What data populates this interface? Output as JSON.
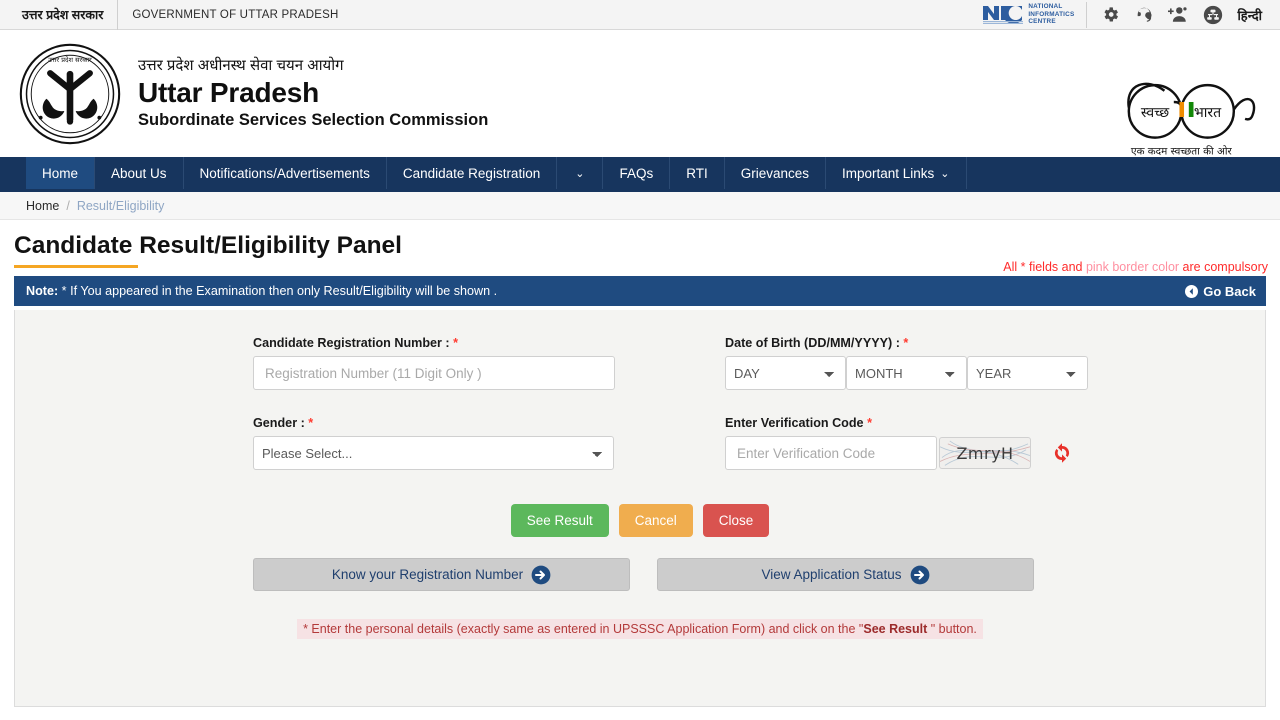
{
  "gov_bar": {
    "hindi_label": "उत्तर प्रदेश सरकार",
    "english_label": "GOVERNMENT OF UTTAR PRADESH",
    "nic_line1": "NATIONAL",
    "nic_line2": "INFORMATICS",
    "nic_line3": "CENTRE",
    "nic_mark": "NIC",
    "icons": [
      {
        "name": "gear-icon",
        "label": "Settings"
      },
      {
        "name": "headset-icon",
        "label": "Support"
      },
      {
        "name": "add-user-icon",
        "label": "Add User"
      },
      {
        "name": "accessibility-icon",
        "label": "Accessibility"
      }
    ],
    "language_label": "हिन्दी"
  },
  "masthead": {
    "hindi_title": "उत्तर प्रदेश अधीनस्थ सेवा चयन आयोग",
    "main_title": "Uttar Pradesh",
    "sub_title": "Subordinate Services Selection Commission",
    "emblem_name": "uttar-pradesh-emblem",
    "swachh_word1": "स्वच्छ",
    "swachh_word2": "भारत",
    "swachh_tagline": "एक कदम स्वच्छता की ओर"
  },
  "nav": {
    "items": [
      {
        "label": "Home",
        "active": true,
        "caret": false
      },
      {
        "label": "About Us",
        "active": false,
        "caret": false
      },
      {
        "label": "Notifications/Advertisements",
        "active": false,
        "caret": false
      },
      {
        "label": "Candidate Registration",
        "active": false,
        "caret": false
      },
      {
        "label": "",
        "active": false,
        "caret": true
      },
      {
        "label": "FAQs",
        "active": false,
        "caret": false
      },
      {
        "label": "RTI",
        "active": false,
        "caret": false
      },
      {
        "label": "Grievances",
        "active": false,
        "caret": false
      },
      {
        "label": "Important Links",
        "active": false,
        "caret": true
      }
    ]
  },
  "breadcrumb": {
    "home": "Home",
    "separator": "/",
    "current": "Result/Eligibility"
  },
  "page": {
    "title": "Candidate Result/Eligibility Panel",
    "compulsory_pre": "All * fields and ",
    "compulsory_pink": "pink border color",
    "compulsory_post": " are compulsory"
  },
  "note": {
    "bold": "Note:",
    "text": " * If You appeared in the Examination then only Result/Eligibility will be shown .",
    "go_back": "Go Back"
  },
  "form": {
    "reg_label": "Candidate Registration Number :",
    "reg_placeholder": "Registration Number (11 Digit Only )",
    "reg_value": "",
    "dob_label": "Date of Birth (DD/MM/YYYY) :",
    "dob_day": "DAY",
    "dob_month": "MONTH",
    "dob_year": "YEAR",
    "gender_label": "Gender :",
    "gender_value": "Please Select...",
    "captcha_label": "Enter Verification Code",
    "captcha_placeholder": "Enter Verification Code",
    "captcha_value": "",
    "captcha_text": "ZmryH",
    "refresh_name": "refresh-captcha-icon"
  },
  "buttons": {
    "see_result": "See Result",
    "cancel": "Cancel",
    "close": "Close",
    "know_reg": "Know your Registration Number",
    "view_status": "View Application Status"
  },
  "footer_note": {
    "pre": "* Enter the personal details (exactly same as entered in UPSSSC Application Form) and click on the ",
    "quote_open": "\"",
    "bold": "See Result",
    "quote_close": " \"",
    "post": " button."
  },
  "colors": {
    "nav_blue": "#17355e",
    "nav_active": "#1f4b80",
    "note_blue": "#1f4b80",
    "accent_orange": "#f5a623",
    "green": "#5cb85c",
    "amber": "#f0ad4e",
    "red": "#d9534f",
    "required_red": "#ff3b30"
  }
}
